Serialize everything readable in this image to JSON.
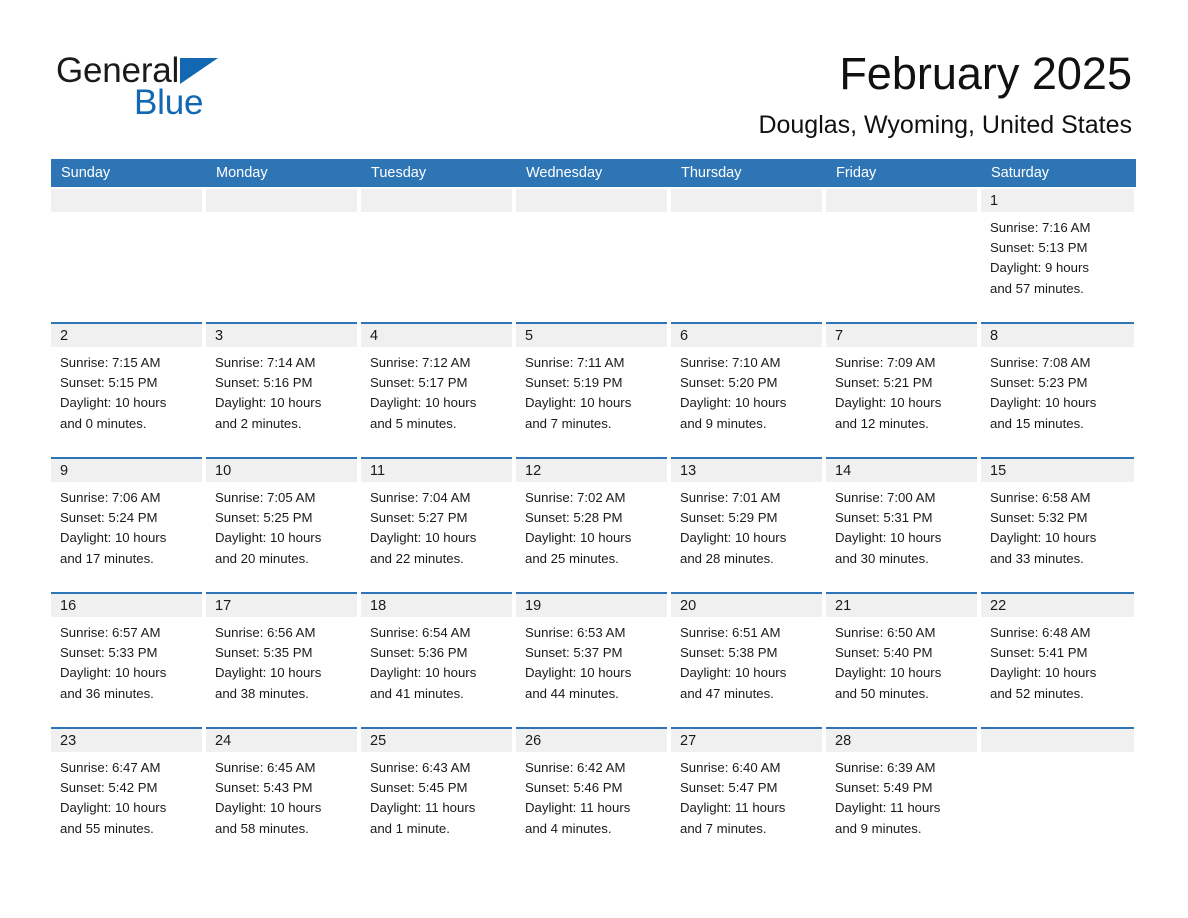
{
  "brand": {
    "line1": "General",
    "line2": "Blue",
    "flag_icon": "brand-triangle-icon",
    "accent_color": "#1268b3"
  },
  "header": {
    "title": "February 2025",
    "subtitle": "Douglas, Wyoming, United States"
  },
  "theme": {
    "header_blue": "#2e75b6",
    "date_band_gray": "#f0f0f0",
    "text_color": "#1a1a1a",
    "page_background": "#ffffff"
  },
  "weekday_headers": [
    "Sunday",
    "Monday",
    "Tuesday",
    "Wednesday",
    "Thursday",
    "Friday",
    "Saturday"
  ],
  "weeks": [
    [
      {
        "day": "",
        "sunrise": "",
        "sunset": "",
        "daylight": "",
        "daylight2": ""
      },
      {
        "day": "",
        "sunrise": "",
        "sunset": "",
        "daylight": "",
        "daylight2": ""
      },
      {
        "day": "",
        "sunrise": "",
        "sunset": "",
        "daylight": "",
        "daylight2": ""
      },
      {
        "day": "",
        "sunrise": "",
        "sunset": "",
        "daylight": "",
        "daylight2": ""
      },
      {
        "day": "",
        "sunrise": "",
        "sunset": "",
        "daylight": "",
        "daylight2": ""
      },
      {
        "day": "",
        "sunrise": "",
        "sunset": "",
        "daylight": "",
        "daylight2": ""
      },
      {
        "day": "1",
        "sunrise": "Sunrise: 7:16 AM",
        "sunset": "Sunset: 5:13 PM",
        "daylight": "Daylight: 9 hours",
        "daylight2": "and 57 minutes."
      }
    ],
    [
      {
        "day": "2",
        "sunrise": "Sunrise: 7:15 AM",
        "sunset": "Sunset: 5:15 PM",
        "daylight": "Daylight: 10 hours",
        "daylight2": "and 0 minutes."
      },
      {
        "day": "3",
        "sunrise": "Sunrise: 7:14 AM",
        "sunset": "Sunset: 5:16 PM",
        "daylight": "Daylight: 10 hours",
        "daylight2": "and 2 minutes."
      },
      {
        "day": "4",
        "sunrise": "Sunrise: 7:12 AM",
        "sunset": "Sunset: 5:17 PM",
        "daylight": "Daylight: 10 hours",
        "daylight2": "and 5 minutes."
      },
      {
        "day": "5",
        "sunrise": "Sunrise: 7:11 AM",
        "sunset": "Sunset: 5:19 PM",
        "daylight": "Daylight: 10 hours",
        "daylight2": "and 7 minutes."
      },
      {
        "day": "6",
        "sunrise": "Sunrise: 7:10 AM",
        "sunset": "Sunset: 5:20 PM",
        "daylight": "Daylight: 10 hours",
        "daylight2": "and 9 minutes."
      },
      {
        "day": "7",
        "sunrise": "Sunrise: 7:09 AM",
        "sunset": "Sunset: 5:21 PM",
        "daylight": "Daylight: 10 hours",
        "daylight2": "and 12 minutes."
      },
      {
        "day": "8",
        "sunrise": "Sunrise: 7:08 AM",
        "sunset": "Sunset: 5:23 PM",
        "daylight": "Daylight: 10 hours",
        "daylight2": "and 15 minutes."
      }
    ],
    [
      {
        "day": "9",
        "sunrise": "Sunrise: 7:06 AM",
        "sunset": "Sunset: 5:24 PM",
        "daylight": "Daylight: 10 hours",
        "daylight2": "and 17 minutes."
      },
      {
        "day": "10",
        "sunrise": "Sunrise: 7:05 AM",
        "sunset": "Sunset: 5:25 PM",
        "daylight": "Daylight: 10 hours",
        "daylight2": "and 20 minutes."
      },
      {
        "day": "11",
        "sunrise": "Sunrise: 7:04 AM",
        "sunset": "Sunset: 5:27 PM",
        "daylight": "Daylight: 10 hours",
        "daylight2": "and 22 minutes."
      },
      {
        "day": "12",
        "sunrise": "Sunrise: 7:02 AM",
        "sunset": "Sunset: 5:28 PM",
        "daylight": "Daylight: 10 hours",
        "daylight2": "and 25 minutes."
      },
      {
        "day": "13",
        "sunrise": "Sunrise: 7:01 AM",
        "sunset": "Sunset: 5:29 PM",
        "daylight": "Daylight: 10 hours",
        "daylight2": "and 28 minutes."
      },
      {
        "day": "14",
        "sunrise": "Sunrise: 7:00 AM",
        "sunset": "Sunset: 5:31 PM",
        "daylight": "Daylight: 10 hours",
        "daylight2": "and 30 minutes."
      },
      {
        "day": "15",
        "sunrise": "Sunrise: 6:58 AM",
        "sunset": "Sunset: 5:32 PM",
        "daylight": "Daylight: 10 hours",
        "daylight2": "and 33 minutes."
      }
    ],
    [
      {
        "day": "16",
        "sunrise": "Sunrise: 6:57 AM",
        "sunset": "Sunset: 5:33 PM",
        "daylight": "Daylight: 10 hours",
        "daylight2": "and 36 minutes."
      },
      {
        "day": "17",
        "sunrise": "Sunrise: 6:56 AM",
        "sunset": "Sunset: 5:35 PM",
        "daylight": "Daylight: 10 hours",
        "daylight2": "and 38 minutes."
      },
      {
        "day": "18",
        "sunrise": "Sunrise: 6:54 AM",
        "sunset": "Sunset: 5:36 PM",
        "daylight": "Daylight: 10 hours",
        "daylight2": "and 41 minutes."
      },
      {
        "day": "19",
        "sunrise": "Sunrise: 6:53 AM",
        "sunset": "Sunset: 5:37 PM",
        "daylight": "Daylight: 10 hours",
        "daylight2": "and 44 minutes."
      },
      {
        "day": "20",
        "sunrise": "Sunrise: 6:51 AM",
        "sunset": "Sunset: 5:38 PM",
        "daylight": "Daylight: 10 hours",
        "daylight2": "and 47 minutes."
      },
      {
        "day": "21",
        "sunrise": "Sunrise: 6:50 AM",
        "sunset": "Sunset: 5:40 PM",
        "daylight": "Daylight: 10 hours",
        "daylight2": "and 50 minutes."
      },
      {
        "day": "22",
        "sunrise": "Sunrise: 6:48 AM",
        "sunset": "Sunset: 5:41 PM",
        "daylight": "Daylight: 10 hours",
        "daylight2": "and 52 minutes."
      }
    ],
    [
      {
        "day": "23",
        "sunrise": "Sunrise: 6:47 AM",
        "sunset": "Sunset: 5:42 PM",
        "daylight": "Daylight: 10 hours",
        "daylight2": "and 55 minutes."
      },
      {
        "day": "24",
        "sunrise": "Sunrise: 6:45 AM",
        "sunset": "Sunset: 5:43 PM",
        "daylight": "Daylight: 10 hours",
        "daylight2": "and 58 minutes."
      },
      {
        "day": "25",
        "sunrise": "Sunrise: 6:43 AM",
        "sunset": "Sunset: 5:45 PM",
        "daylight": "Daylight: 11 hours",
        "daylight2": "and 1 minute."
      },
      {
        "day": "26",
        "sunrise": "Sunrise: 6:42 AM",
        "sunset": "Sunset: 5:46 PM",
        "daylight": "Daylight: 11 hours",
        "daylight2": "and 4 minutes."
      },
      {
        "day": "27",
        "sunrise": "Sunrise: 6:40 AM",
        "sunset": "Sunset: 5:47 PM",
        "daylight": "Daylight: 11 hours",
        "daylight2": "and 7 minutes."
      },
      {
        "day": "28",
        "sunrise": "Sunrise: 6:39 AM",
        "sunset": "Sunset: 5:49 PM",
        "daylight": "Daylight: 11 hours",
        "daylight2": "and 9 minutes."
      },
      {
        "day": "",
        "sunrise": "",
        "sunset": "",
        "daylight": "",
        "daylight2": ""
      }
    ]
  ]
}
